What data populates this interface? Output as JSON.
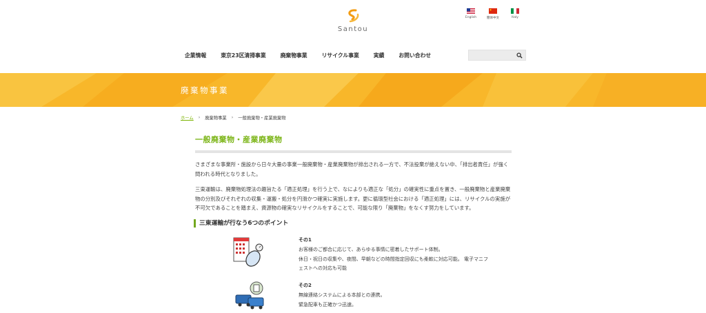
{
  "brand": {
    "logo_text": "Santou"
  },
  "languages": [
    {
      "label": "English"
    },
    {
      "label": "簡体中文"
    },
    {
      "label": "Italy"
    }
  ],
  "nav": [
    "企業情報",
    "東京23区清掃事業",
    "廃棄物事業",
    "リサイクル事業",
    "実績",
    "お問い合わせ"
  ],
  "search": {
    "placeholder": "",
    "value": ""
  },
  "banner": {
    "title": "廃棄物事業"
  },
  "breadcrumb": {
    "home": "ホーム",
    "parent": "廃棄物事業",
    "current": "一般廃棄物・産業廃棄物"
  },
  "main": {
    "heading": "一般廃棄物・産業廃棄物",
    "para1": "さまざまな事業所・施設から日々大量の事業一般廃棄物・産業廃棄物が排出される一方で、不法投棄が絶えない中、「排出者責任」が強く問われる時代となりました。",
    "para2": "三東運輸は、廃棄物処理法の趣旨たる「適正処理」を行う上で、なによりも適正な「処分」の確実性に重点を置き、一般廃棄物と産業廃棄物の分別及びそれぞれの収集・運搬・処分を円滑かつ確実に実施します。更に循環型社会における「適正処理」には、リサイクルの実施が不可欠であることを踏まえ、資源物の確実なリサイクルをすることで、可能な限り「廃棄物」をなくす努力をしています。",
    "points_heading": "三東運輸が行なう6つのポイント",
    "points": [
      {
        "title": "その1",
        "lines": [
          "お客様のご都合に応じて、あらゆる事情に密着したサポート体制。",
          "休日・祝日の収集や、夜間、早朝などの時間指定回収にも柔軟に対応可能。 電子マニフ",
          "ェストへの対応も可能"
        ]
      },
      {
        "title": "その2",
        "lines": [
          "無線連絡システムによる本部との連携。",
          "緊急配車も正確かつ迅速。"
        ]
      }
    ]
  },
  "colors": {
    "accent_green": "#7cb518",
    "banner_yellow": "#f8b72a",
    "logo_orange": "#f39c12"
  }
}
